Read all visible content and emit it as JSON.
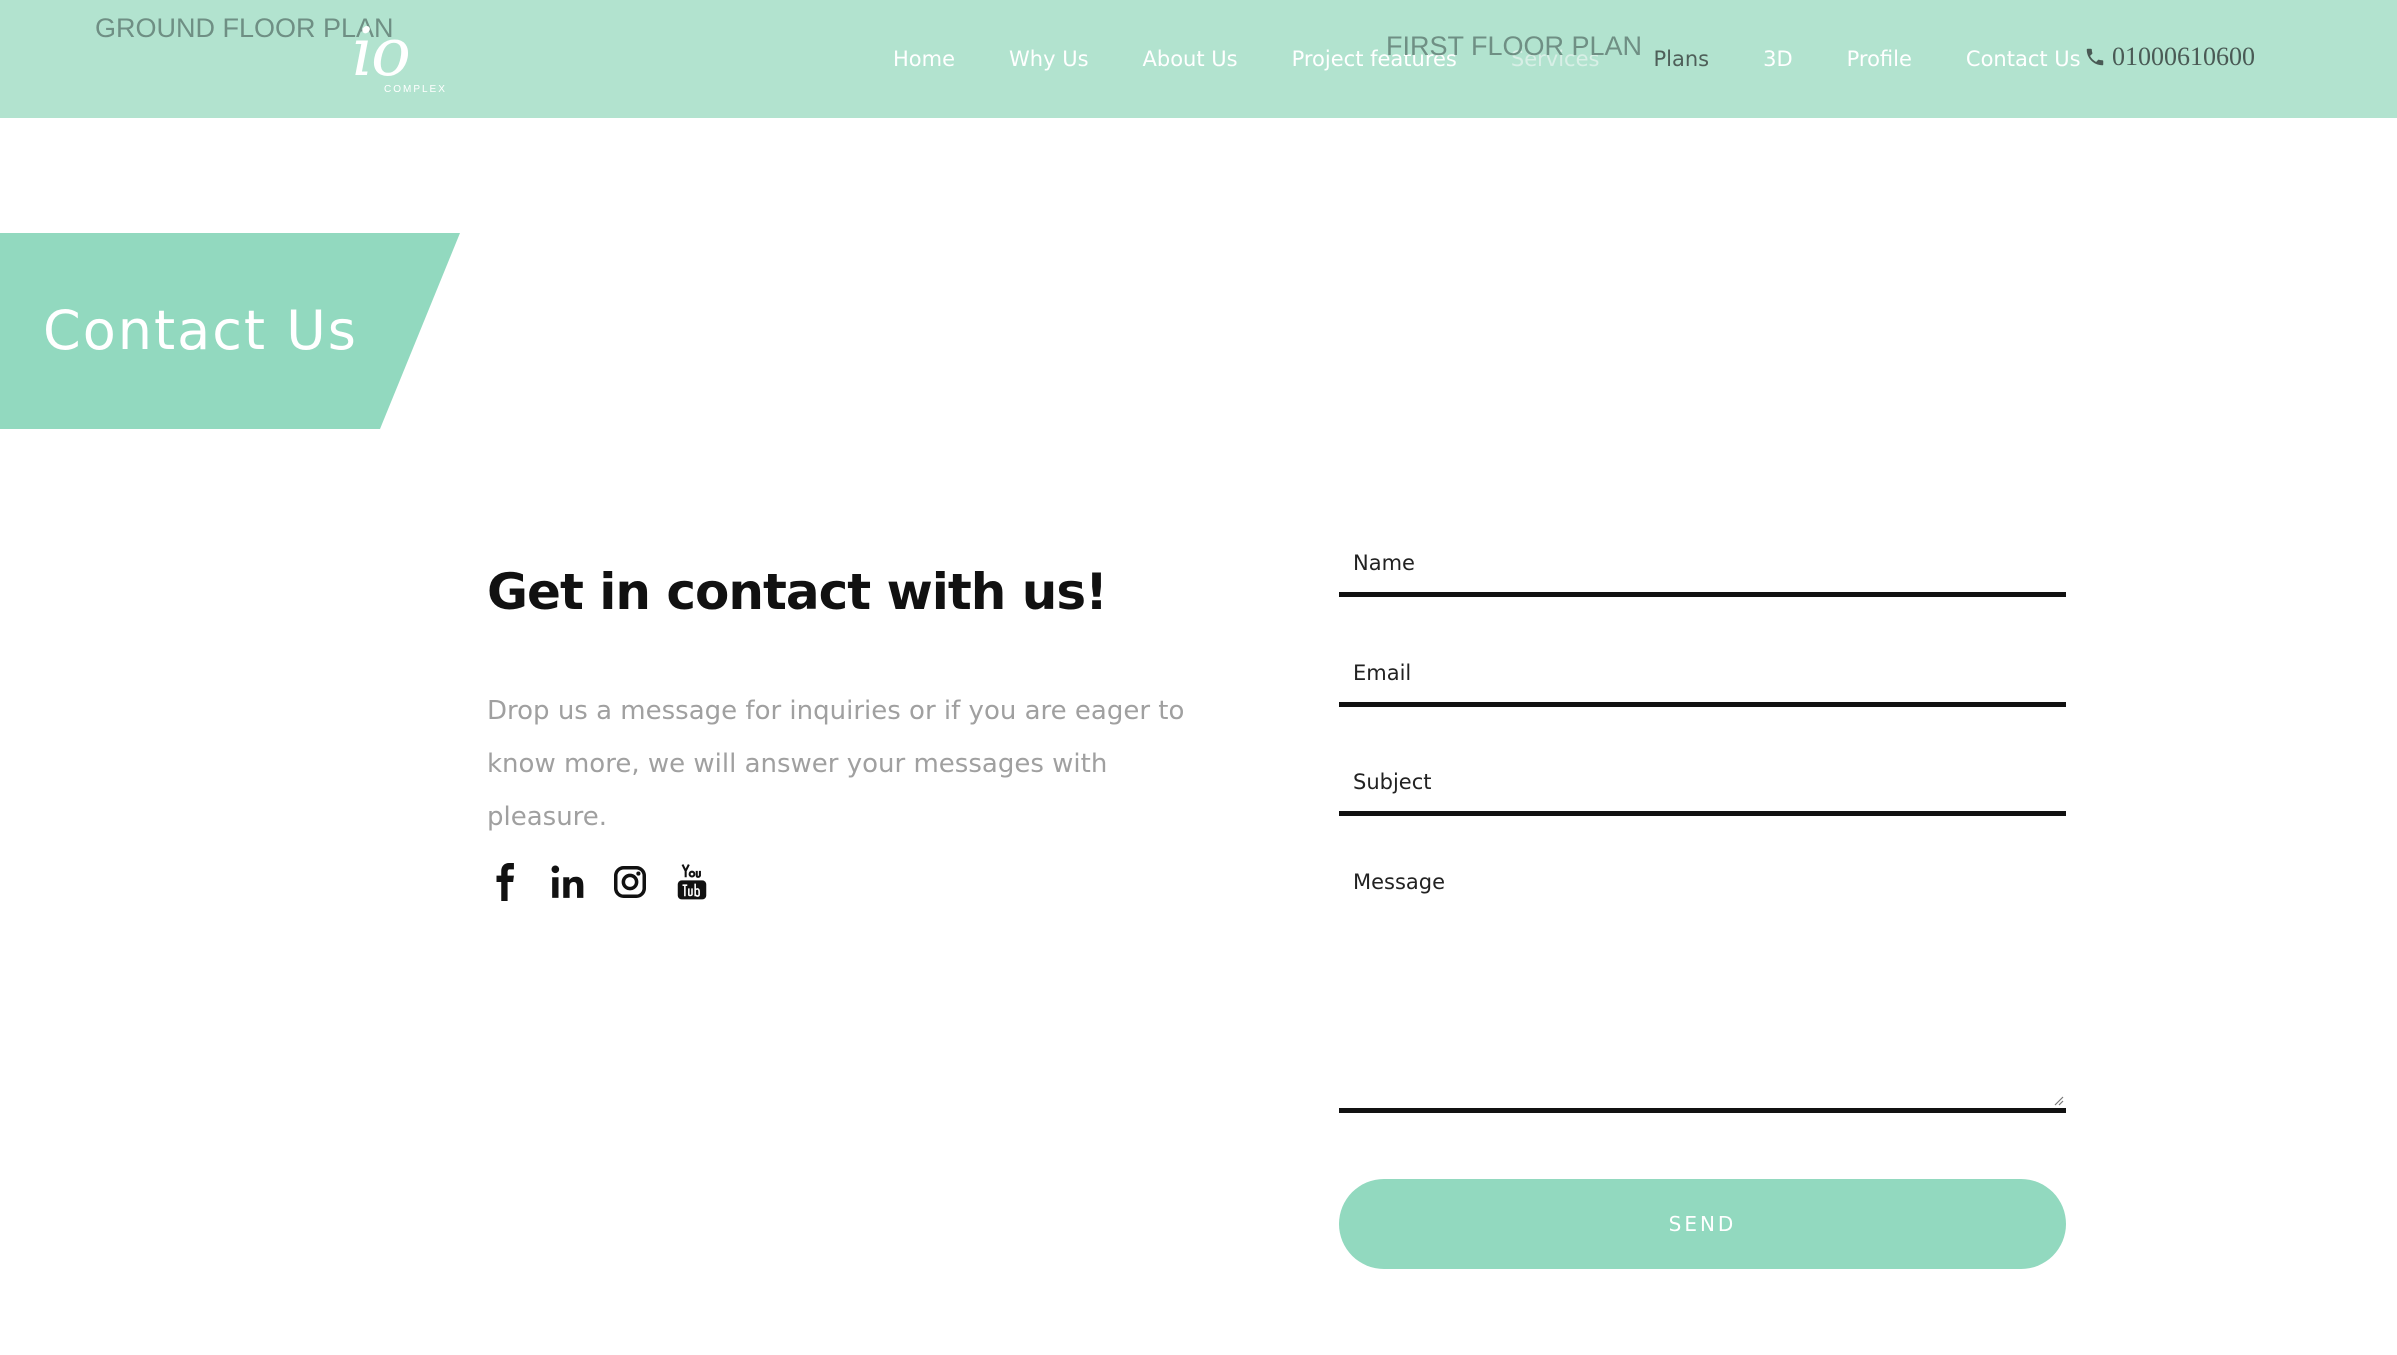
{
  "colors": {
    "nav_background": "#b2e3cf",
    "accent": "#92d9bf",
    "banner": "#92d9bf",
    "heading_text": "#111111",
    "muted_text": "#a0a0a0"
  },
  "overlay_labels": {
    "ground_floor": "GROUND FLOOR PLAN",
    "first_floor": "FIRST FLOOR PLAN"
  },
  "logo": {
    "mark": "io",
    "sub": "COMPLEX"
  },
  "nav": {
    "items": [
      {
        "label": "Home"
      },
      {
        "label": "Why Us"
      },
      {
        "label": "About Us"
      },
      {
        "label": "Project features"
      },
      {
        "label": "Services"
      },
      {
        "label": "Plans"
      },
      {
        "label": "3D"
      },
      {
        "label": "Profile"
      },
      {
        "label": "Contact Us"
      }
    ],
    "phone": "01000610600",
    "phone_icon": "phone-icon"
  },
  "banner": {
    "title": "Contact Us"
  },
  "contact": {
    "heading": "Get in contact with us!",
    "description": "Drop us a message for inquiries or if you are eager to know more, we will answer your messages with pleasure.",
    "social": [
      {
        "icon": "facebook-icon"
      },
      {
        "icon": "linkedin-icon"
      },
      {
        "icon": "instagram-icon"
      },
      {
        "icon": "youtube-icon"
      }
    ]
  },
  "form": {
    "name_placeholder": "Name",
    "email_placeholder": "Email",
    "subject_placeholder": "Subject",
    "message_placeholder": "Message",
    "send_label": "SEND"
  }
}
